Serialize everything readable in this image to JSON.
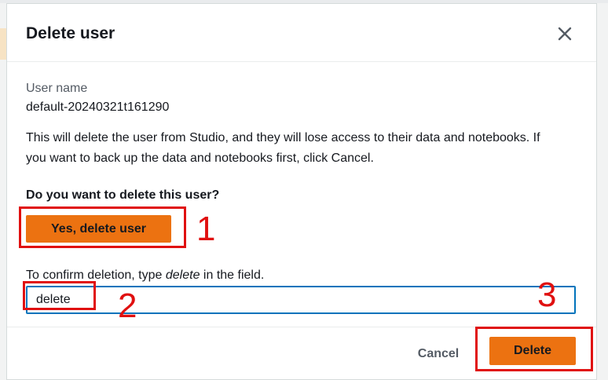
{
  "dialog": {
    "title": "Delete user",
    "close_icon": "close-icon",
    "user_name_label": "User name",
    "user_name_value": "default-20240321t161290",
    "description": "This will delete the user from Studio, and they will lose access to their data and notebooks. If you want to back up the data and notebooks first, click Cancel.",
    "question": "Do you want to delete this user?",
    "yes_button_label": "Yes, delete user",
    "confirm_label_prefix": "To confirm deletion, type ",
    "confirm_label_keyword": "delete",
    "confirm_label_suffix": " in the field.",
    "confirm_input_value": "delete",
    "cancel_label": "Cancel",
    "delete_label": "Delete"
  },
  "annotations": {
    "step1": "1",
    "step2": "2",
    "step3": "3",
    "color": "#e01010"
  },
  "colors": {
    "primary_button": "#ec7211",
    "focus_border": "#0073bb",
    "text": "#16191f",
    "secondary_text": "#545b64"
  }
}
